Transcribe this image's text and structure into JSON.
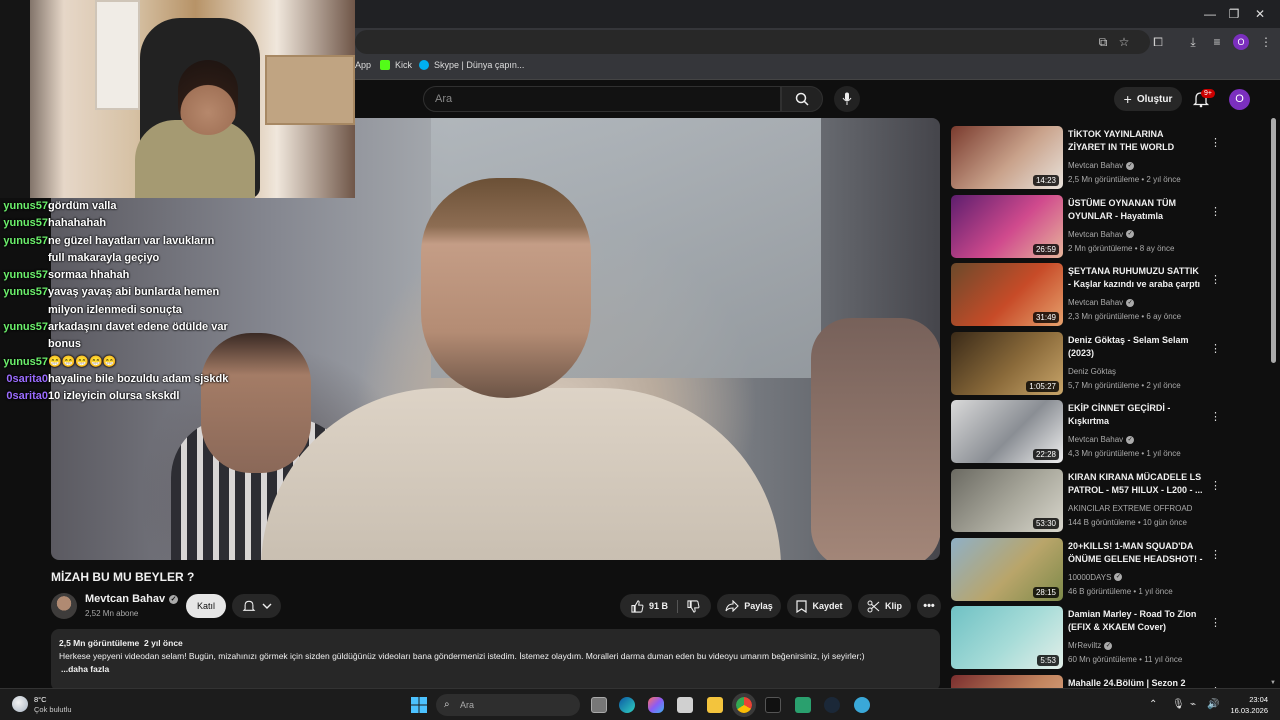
{
  "browser": {
    "bookmarks": [
      {
        "label": "App"
      },
      {
        "label": "Kick"
      },
      {
        "label": "Skype | Dünya çapın..."
      }
    ],
    "profile_initial": "O"
  },
  "youtube_header": {
    "search_placeholder": "Ara",
    "create_label": "Oluştur",
    "notification_badge": "9+",
    "avatar_initial": "O"
  },
  "stream_chat": [
    {
      "user": "yunus57",
      "message": "gördüm valla",
      "color": "#6cf06c"
    },
    {
      "user": "yunus57",
      "message": "hahahahah",
      "color": "#6cf06c"
    },
    {
      "user": "yunus57",
      "message": "ne güzel hayatları var lavukların full makarayla geçiyo",
      "color": "#6cf06c"
    },
    {
      "user": "yunus57",
      "message": "sormaa hhahah",
      "color": "#6cf06c"
    },
    {
      "user": "yunus57",
      "message": "yavaş yavaş abi bunlarda hemen milyon izlenmedi sonuçta",
      "color": "#6cf06c"
    },
    {
      "user": "yunus57",
      "message": "arkadaşını davet edene ödülde var bonus",
      "color": "#6cf06c"
    },
    {
      "user": "yunus57",
      "message": "😁😁😁😁😁",
      "color": "#6cf06c"
    },
    {
      "user": "0sarita0",
      "message": "hayaline bile bozuldu adam sjskdk",
      "color": "#9b6cff"
    },
    {
      "user": "0sarita0",
      "message": "10 izleyicin olursa skskdl",
      "color": "#9b6cff"
    }
  ],
  "video": {
    "title": "MİZAH BU MU BEYLER ?",
    "channel": "Mevtcan Bahav",
    "subscribers": "2,52 Mn abone",
    "join_label": "Katıl",
    "likes": "91 B",
    "share_label": "Paylaş",
    "save_label": "Kaydet",
    "clip_label": "Klip",
    "views": "2,5 Mn görüntüleme",
    "age": "2 yıl önce",
    "description": "Herkese yepyeni videodan selam! Bugün, mizahınızı görmek için sizden güldüğünüz videoları bana göndermenizi istedim. İstemez olaydım. Moralleri darma duman eden bu videoyu umarım beğenirsiniz, iyi seyirler;)",
    "more_label": "...daha fazla"
  },
  "recommendations": [
    {
      "title": "TİKTOK YAYINLARINA ZİYARET IN THE WORLD",
      "channel": "Mevtcan Bahav",
      "verified": true,
      "views": "2,5 Mn görüntüleme",
      "age": "2 yıl önce",
      "duration": "14:23",
      "colors": [
        "#7a3b2e",
        "#c9a28b",
        "#e9e3dc"
      ]
    },
    {
      "title": "ÜSTÜME OYNANAN TÜM OYUNLAR - Hayatımla oynandı..",
      "channel": "Mevtcan Bahav",
      "verified": true,
      "views": "2 Mn görüntüleme",
      "age": "8 ay önce",
      "duration": "26:59",
      "colors": [
        "#5d1e6e",
        "#d04a8d",
        "#e7b59a"
      ]
    },
    {
      "title": "ŞEYTANA RUHUMUZU SATTIK - Kaşlar kazındı ve araba çarptı ...",
      "channel": "Mevtcan Bahav",
      "verified": true,
      "views": "2,3 Mn görüntüleme",
      "age": "6 ay önce",
      "duration": "31:49",
      "colors": [
        "#6b4a2b",
        "#c74b28",
        "#e6a16d"
      ]
    },
    {
      "title": "Deniz Göktaş - Selam Selam (2023)",
      "channel": "Deniz Göktaş",
      "verified": false,
      "views": "5,7 Mn görüntüleme",
      "age": "2 yıl önce",
      "duration": "1:05:27",
      "colors": [
        "#3a2a18",
        "#8a6a3a",
        "#c8a56a"
      ]
    },
    {
      "title": "EKİP CİNNET GEÇİRDİ - Kışkırtma",
      "channel": "Mevtcan Bahav",
      "verified": true,
      "views": "4,3 Mn görüntüleme",
      "age": "1 yıl önce",
      "duration": "22:28",
      "colors": [
        "#d9d9d9",
        "#8a8e94",
        "#efefef"
      ]
    },
    {
      "title": "KIRAN KIRANA MÜCADELE LS PATROL - M57 HILUX - L200 - ...",
      "channel": "AKINCILAR EXTREME OFFROAD",
      "verified": false,
      "views": "144 B görüntüleme",
      "age": "10 gün önce",
      "duration": "53:30",
      "colors": [
        "#6b6a62",
        "#a9a89c",
        "#d8d6cc"
      ]
    },
    {
      "title": "20+KILLS! 1-MAN SQUAD'DA ÖNÜME GELENE HEADSHOT! - ...",
      "channel": "10000DAYS",
      "verified": true,
      "views": "46 B görüntüleme",
      "age": "1 yıl önce",
      "duration": "28:15",
      "colors": [
        "#8fb0c6",
        "#b9a56a",
        "#7d8a4a"
      ]
    },
    {
      "title": "Damian Marley - Road To Zion (EFIX & XKAEM Cover)",
      "channel": "MrReviltz",
      "verified": true,
      "views": "60 Mn görüntüleme",
      "age": "11 yıl önce",
      "duration": "5:53",
      "colors": [
        "#6fc1c4",
        "#a7dcd8",
        "#e3efe9"
      ]
    },
    {
      "title": "Mahalle 24.Bölüm | Sezon 2",
      "channel": "",
      "verified": false,
      "views": "",
      "age": "",
      "duration": "",
      "colors": [
        "#7a2e2e",
        "#c2845e",
        "#e1b08e"
      ]
    }
  ],
  "taskbar": {
    "temperature": "8°C",
    "weather": "Çok bulutlu",
    "search_placeholder": "Ara",
    "time": "23:04",
    "date": "16.03.2026"
  }
}
